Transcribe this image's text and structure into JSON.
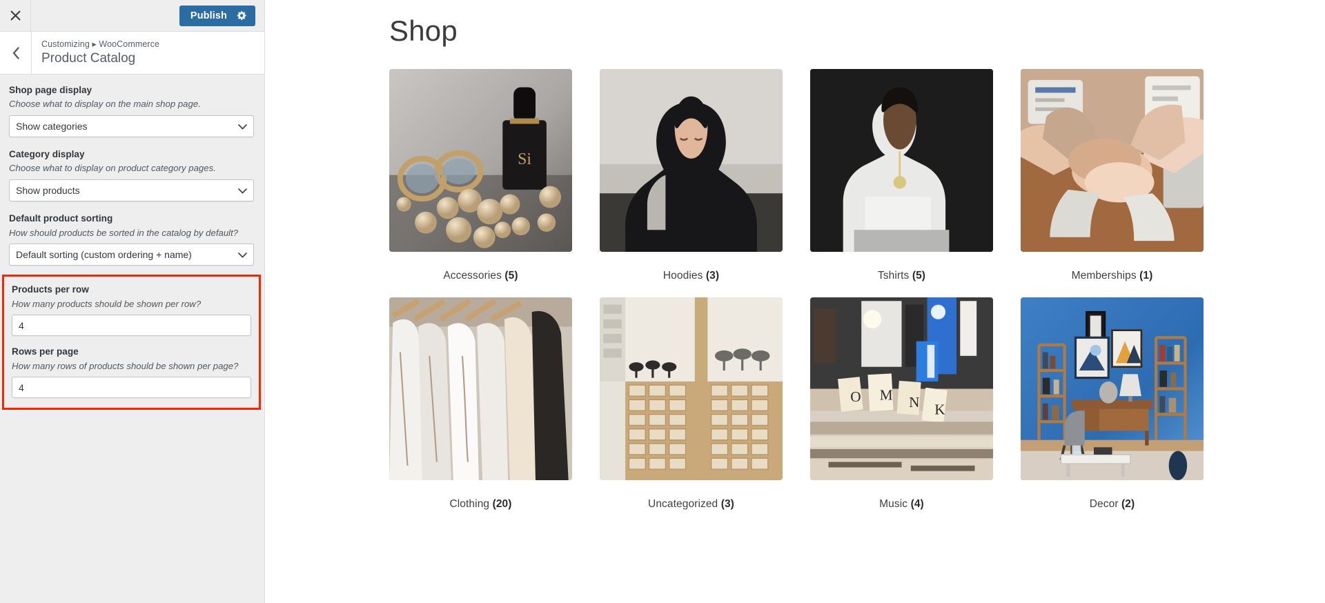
{
  "customizer": {
    "close_icon": "close-x-icon",
    "publish_label": "Publish",
    "publish_gear_icon": "gear-icon",
    "back_icon": "chevron-left-icon",
    "breadcrumb": "Customizing ▸ WooCommerce",
    "panel_title": "Product Catalog",
    "accent_color": "#2b6ca3",
    "highlight_color": "#f92500",
    "controls": [
      {
        "name": "shop-page-display",
        "label": "Shop page display",
        "description": "Choose what to display on the main shop page.",
        "type": "select",
        "value": "Show categories"
      },
      {
        "name": "category-display",
        "label": "Category display",
        "description": "Choose what to display on product category pages.",
        "type": "select",
        "value": "Show products"
      },
      {
        "name": "default-product-sorting",
        "label": "Default product sorting",
        "description": "How should products be sorted in the catalog by default?",
        "type": "select",
        "value": "Default sorting (custom ordering + name)"
      },
      {
        "name": "products-per-row",
        "label": "Products per row",
        "description": "How many products should be shown per row?",
        "type": "number",
        "value": "4"
      },
      {
        "name": "rows-per-page",
        "label": "Rows per page",
        "description": "How many rows of products should be shown per page?",
        "type": "number",
        "value": "4"
      }
    ]
  },
  "preview": {
    "page_title": "Shop",
    "categories": [
      {
        "name": "Accessories",
        "count": "(5)",
        "image": "perfume-jewelry-photo"
      },
      {
        "name": "Hoodies",
        "count": "(3)",
        "image": "hooded-man-photo"
      },
      {
        "name": "Tshirts",
        "count": "(5)",
        "image": "white-tshirt-man-photo"
      },
      {
        "name": "Memberships",
        "count": "(1)",
        "image": "hands-together-photo"
      },
      {
        "name": "Clothing",
        "count": "(20)",
        "image": "clothes-rack-photo"
      },
      {
        "name": "Uncategorized",
        "count": "(3)",
        "image": "card-catalog-photo"
      },
      {
        "name": "Music",
        "count": "(4)",
        "image": "record-store-photo"
      },
      {
        "name": "Decor",
        "count": "(2)",
        "image": "blue-room-desk-photo"
      }
    ]
  }
}
